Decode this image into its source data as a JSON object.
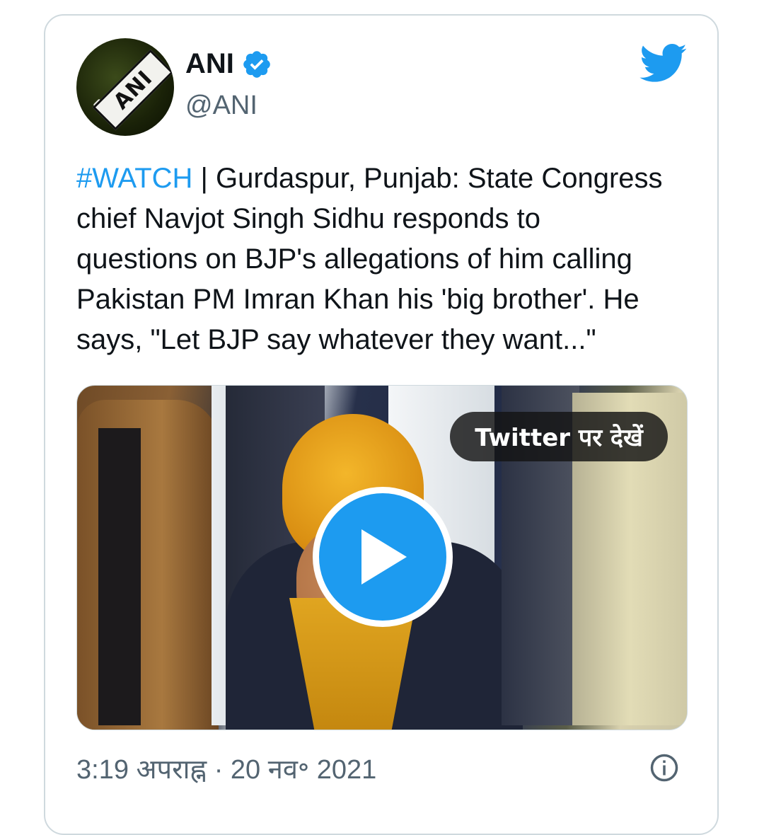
{
  "tweet": {
    "author_name": "ANI",
    "author_handle": "@ANI",
    "avatar_text": "ANI",
    "verified": true,
    "hashtag": "#WATCH",
    "text_rest": " | Gurdaspur, Punjab: State Congress\nchief Navjot Singh Sidhu responds to\nquestions on BJP's allegations of him calling\nPakistan PM Imran Khan his 'big brother'. He\nsays, \"Let BJP say whatever they want...\"",
    "media": {
      "watch_label": "Twitter पर देखें",
      "play_icon": "play-icon"
    },
    "timestamp": "3:19 अपराह्न · 20 नव॰ 2021",
    "icons": {
      "logo": "twitter-bird-icon",
      "verified": "verified-badge-icon",
      "info": "info-icon"
    }
  },
  "colors": {
    "accent": "#1d9bf0",
    "text": "#0f1419",
    "secondary": "#536471",
    "border": "#cfd9de"
  }
}
